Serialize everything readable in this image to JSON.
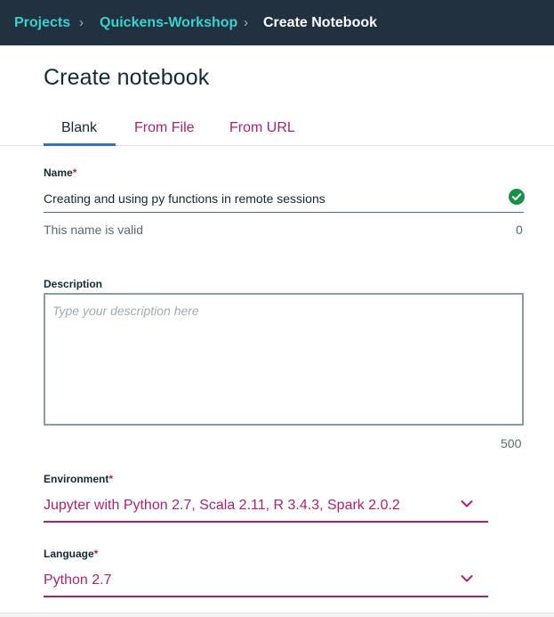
{
  "breadcrumb": {
    "items": [
      "Projects",
      "Quickens-Workshop"
    ],
    "current": "Create Notebook",
    "separator": ">"
  },
  "page": {
    "title": "Create notebook"
  },
  "tabs": [
    {
      "label": "Blank",
      "active": true
    },
    {
      "label": "From File",
      "active": false
    },
    {
      "label": "From URL",
      "active": false
    }
  ],
  "name_field": {
    "label": "Name",
    "required_marker": "*",
    "value": "Creating and using py functions in remote sessions",
    "status_icon": "check-circle-icon",
    "helper_text": "This name is valid",
    "counter": "0"
  },
  "description_field": {
    "label": "Description",
    "placeholder": "Type your description here",
    "value": "",
    "counter": "500"
  },
  "environment_field": {
    "label": "Environment",
    "required_marker": "*",
    "selected": "Jupyter with Python 2.7, Scala 2.11, R 3.4.3, Spark 2.0.2",
    "icon": "chevron-down-icon"
  },
  "language_field": {
    "label": "Language",
    "required_marker": "*",
    "selected": "Python 2.7",
    "icon": "chevron-down-icon"
  },
  "colors": {
    "topbar": "#213140",
    "link": "#3ecfcf",
    "accent": "#a6266e",
    "tab_active_underline": "#3d70b2",
    "valid": "#1a8f4a"
  }
}
